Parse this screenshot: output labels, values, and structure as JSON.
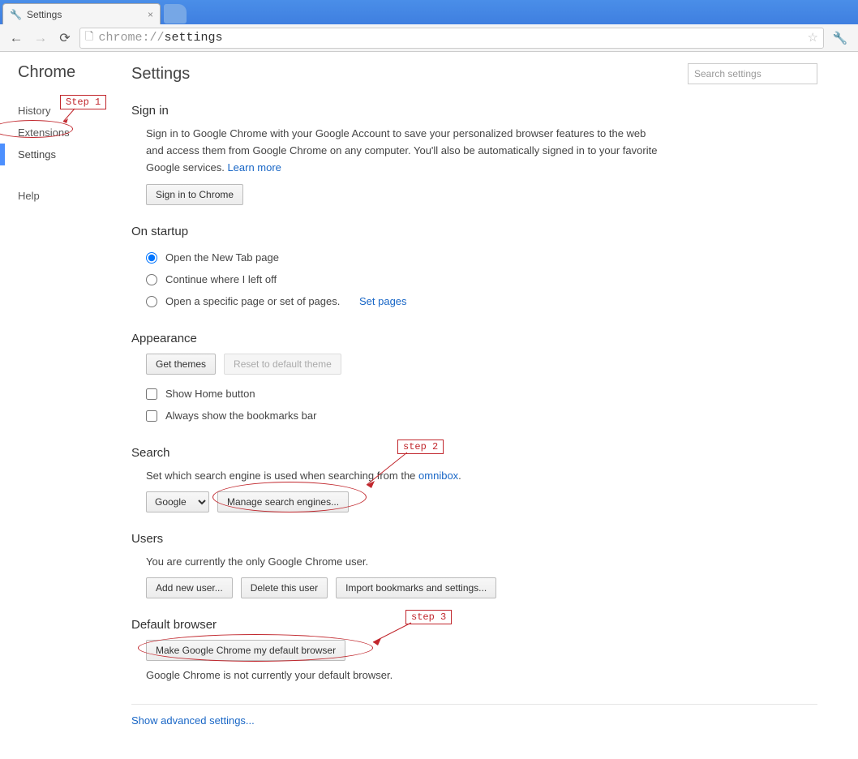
{
  "browserTab": {
    "title": "Settings"
  },
  "omnibox": {
    "prefix": "chrome://",
    "path": "settings"
  },
  "sidebar": {
    "title": "Chrome",
    "items": [
      "History",
      "Extensions",
      "Settings"
    ],
    "help": "Help"
  },
  "page": {
    "title": "Settings",
    "searchPlaceholder": "Search settings"
  },
  "signin": {
    "heading": "Sign in",
    "desc1": "Sign in to Google Chrome with your Google Account to save your personalized browser features to the web and access them from Google Chrome on any computer. You'll also be automatically signed in to your favorite Google services. ",
    "learn": "Learn more",
    "button": "Sign in to Chrome"
  },
  "startup": {
    "heading": "On startup",
    "opt1": "Open the New Tab page",
    "opt2": "Continue where I left off",
    "opt3": "Open a specific page or set of pages.",
    "setpages": "Set pages"
  },
  "appearance": {
    "heading": "Appearance",
    "getthemes": "Get themes",
    "reset": "Reset to default theme",
    "home": "Show Home button",
    "bookmarks": "Always show the bookmarks bar"
  },
  "search": {
    "heading": "Search",
    "desc": "Set which search engine is used when searching from the ",
    "omni": "omnibox",
    "engine": "Google",
    "manage": "Manage search engines..."
  },
  "users": {
    "heading": "Users",
    "desc": "You are currently the only Google Chrome user.",
    "add": "Add new user...",
    "del": "Delete this user",
    "import": "Import bookmarks and settings..."
  },
  "defaultbrowser": {
    "heading": "Default browser",
    "make": "Make Google Chrome my default browser",
    "status": "Google Chrome is not currently your default browser."
  },
  "advanced": "Show advanced settings...",
  "annotations": {
    "step1": "Step 1",
    "step2": "step 2",
    "step3": "step 3"
  }
}
